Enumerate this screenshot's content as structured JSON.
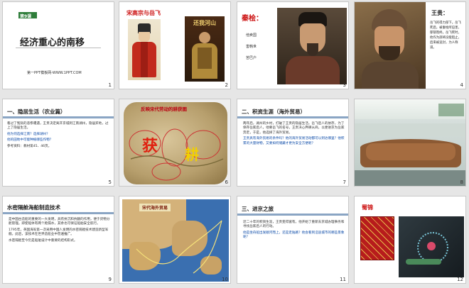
{
  "slides": [
    {
      "number": "1",
      "badge": "第9课",
      "title": "经济重心的南移",
      "footer": "第一PPT模板网-WWW.1PPT.COM"
    },
    {
      "number": "2",
      "title": "宋高宗与岳飞",
      "calligraphy": "还我河山"
    },
    {
      "number": "3",
      "title": "秦桧：",
      "items": [
        "他卖国",
        "害韩世",
        "苦巴户"
      ]
    },
    {
      "number": "4",
      "title": "王贵：",
      "text": "岳飞的得力部下。岳飞死后，被秦桧所迫害，郁郁而终。岳飞死时，他作为部将没能阻止，后来被追封，为人称道。"
    },
    {
      "number": "5",
      "title": "一、隐居生活（农业篇）",
      "bullets": [
        "看过了冤狱的悲惨遭遇，王贵决定离开京城到江南湖州，隐居买地，过上了隐居生活。",
        "他为何选择江南？选择湖州？",
        "他的田地中可能种植哪些作物？",
        "参考资料：教材第45、46页。"
      ]
    },
    {
      "number": "6",
      "title": "反映宋代劳动的耕获图",
      "big1": "获",
      "big2": "耕"
    },
    {
      "number": "7",
      "title": "二、积资生涯（海外贸易）",
      "bullets": [
        "两年后，湖州的乡村，打破了王贵的隐居生活。岳飞后人的依存，为了保存岳家后人，他要岳飞的名号，王贵决心弃耕从商，以便进京为岳家奔走，于是，他选择了海外贸易。",
        "王贵具有海外贸易的条件吗？他的海外贸易活动都可以到达哪里？他积累的大量财物，又要如何储藏才更为安全方便呢？"
      ]
    },
    {
      "number": "8"
    },
    {
      "number": "9",
      "title": "水密隔舱海船制造技术",
      "bullets": [
        "是中国古造船的重要的一大发明，具有抗沉和抗翻的作用，便于货物分舱管理。即使船体有两个舱漏水，其余也可保证船舶安全航行。",
        "1795年，英国海军第一次采用中国人发明的水密隔舱技术建造新型军舰。此后，该技术在世界造船业中普遍推广。",
        "水密隔舱至今仍是船舶设计中重要的结构形式。"
      ]
    },
    {
      "number": "10",
      "map_title": "宋代海外贸易"
    },
    {
      "number": "11",
      "title": "三、进京之旅",
      "bullets": [
        "近二十年的积资生涯，王贵变得富有。他开始了重新去京城办理事务和寻找岳家后人的行动。",
        "他是坐舟船出发顺河而上，还是走陆路？他会看到沿途城市的哪些景象呢？"
      ]
    },
    {
      "number": "12",
      "title": "蜀锦"
    }
  ],
  "colors": {
    "accent": "#c11111",
    "green": "#2e7d3a",
    "stripe": "#8aa5c4"
  }
}
